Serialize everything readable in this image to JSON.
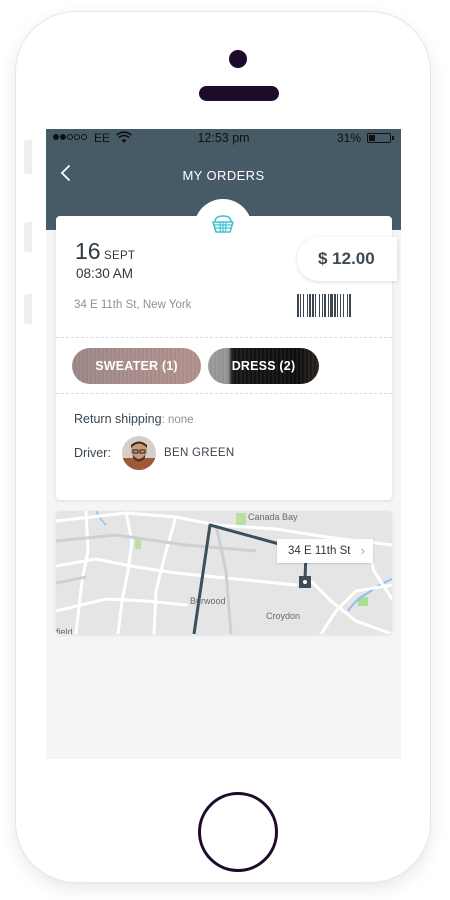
{
  "status_bar": {
    "carrier": "EE",
    "time": "12:53 pm",
    "battery": "31%",
    "battery_level": 0.31
  },
  "header": {
    "title": "MY ORDERS",
    "back_icon": "chevron-left-icon",
    "color": "#475b66"
  },
  "order": {
    "icon": "basket-icon",
    "date_day": "16",
    "date_month": "SEPT",
    "time": "08:30 AM",
    "address": "34 E 11th St, New York",
    "price": "$ 12.00",
    "items": [
      {
        "label": "SWEATER (1)"
      },
      {
        "label": "DRESS (2)"
      }
    ],
    "return_label": "Return shipping",
    "return_sep": ":",
    "return_value": " none",
    "driver_label": "Driver:",
    "driver_name": "BEN GREEN"
  },
  "map": {
    "callout": "34 E 11th St",
    "labels": {
      "canada": "Canada Bay",
      "burwood": "Burwood",
      "croydon": "Croydon",
      "field": "field"
    }
  },
  "accent_color": "#3ec3d4"
}
